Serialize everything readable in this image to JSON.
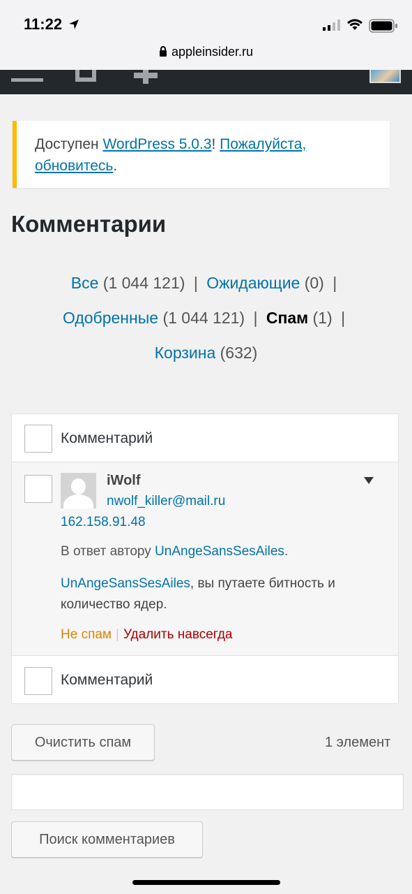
{
  "status_bar": {
    "time": "11:22",
    "url": "appleinsider.ru"
  },
  "admin_bar": {
    "icons": [
      "menu-icon",
      "home-icon",
      "plus-icon",
      "avatar"
    ]
  },
  "notice": {
    "prefix": "Доступен ",
    "version_link": "WordPress 5.0.3",
    "middle": "! ",
    "update_link": "Пожалуйста, обновитесь",
    "suffix": "."
  },
  "page": {
    "title": "Комментарии"
  },
  "filters": {
    "all_label": "Все",
    "all_count": "(1 044 121)",
    "pending_label": "Ожидающие",
    "pending_count": "(0)",
    "approved_label": "Одобренные",
    "approved_count": "(1 044 121)",
    "spam_label": "Спам",
    "spam_count": "(1)",
    "trash_label": "Корзина",
    "trash_count": "(632)",
    "separator": "|"
  },
  "table": {
    "column_header": "Комментарий",
    "column_footer": "Комментарий",
    "comment": {
      "author": "iWolf",
      "email": "nwolf_killer@mail.ru",
      "ip": "162.158.91.48",
      "in_reply_prefix": "В ответ автору ",
      "in_reply_author": "UnAngeSansSesAiles",
      "in_reply_suffix": ".",
      "body_mention": "UnAngeSansSesAiles",
      "body_text": ", вы путаете битность и количество ядер.",
      "action_not_spam": "Не спам",
      "action_separator": "|",
      "action_delete": "Удалить навсегда"
    }
  },
  "bottom": {
    "empty_spam_button": "Очистить спам",
    "items_count": "1 элемент",
    "search_value": "",
    "search_button": "Поиск комментариев"
  },
  "colors": {
    "link": "#0073aa",
    "notice_accent": "#ffb900",
    "not_spam": "#d98500",
    "delete": "#aa0000",
    "admin_bar": "#23282d"
  }
}
